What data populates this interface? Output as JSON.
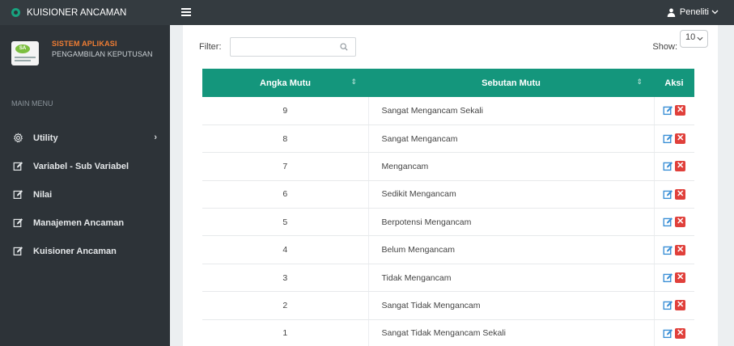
{
  "app": {
    "title": "KUISIONER ANCAMAN"
  },
  "profile": {
    "line1": "SISTEM APLIKASI",
    "line2": "PENGAMBILAN KEPUTUSAN",
    "logo_text": "SA"
  },
  "menu": {
    "header": "MAIN MENU",
    "items": [
      {
        "label": "Utility",
        "icon": "gear-icon",
        "chevron": "›"
      },
      {
        "label": "Variabel - Sub Variabel",
        "icon": "edit-icon"
      },
      {
        "label": "Nilai",
        "icon": "edit-icon"
      },
      {
        "label": "Manajemen Ancaman",
        "icon": "edit-icon"
      },
      {
        "label": "Kuisioner Ancaman",
        "icon": "edit-icon"
      }
    ]
  },
  "topbar": {
    "user": "Peneliti"
  },
  "filter": {
    "label": "Filter:",
    "value": ""
  },
  "show": {
    "label": "Show:",
    "value": "10"
  },
  "table": {
    "headers": [
      "Angka Mutu",
      "Sebutan Mutu",
      "Aksi"
    ],
    "rows": [
      {
        "angka": "9",
        "sebutan": "Sangat Mengancam Sekali"
      },
      {
        "angka": "8",
        "sebutan": "Sangat Mengancam"
      },
      {
        "angka": "7",
        "sebutan": "Mengancam"
      },
      {
        "angka": "6",
        "sebutan": "Sedikit Mengancam"
      },
      {
        "angka": "5",
        "sebutan": "Berpotensi Mengancam"
      },
      {
        "angka": "4",
        "sebutan": "Belum Mengancam"
      },
      {
        "angka": "3",
        "sebutan": "Tidak Mengancam"
      },
      {
        "angka": "2",
        "sebutan": "Sangat Tidak Mengancam"
      },
      {
        "angka": "1",
        "sebutan": "Sangat Tidak Mengancam Sekali"
      }
    ]
  },
  "colors": {
    "accent": "#14967c",
    "sidebar": "#2d3338",
    "topbar": "#343b40",
    "delete": "#e0403b",
    "edit": "#3a8fd6",
    "brand_orange": "#f07d33"
  }
}
